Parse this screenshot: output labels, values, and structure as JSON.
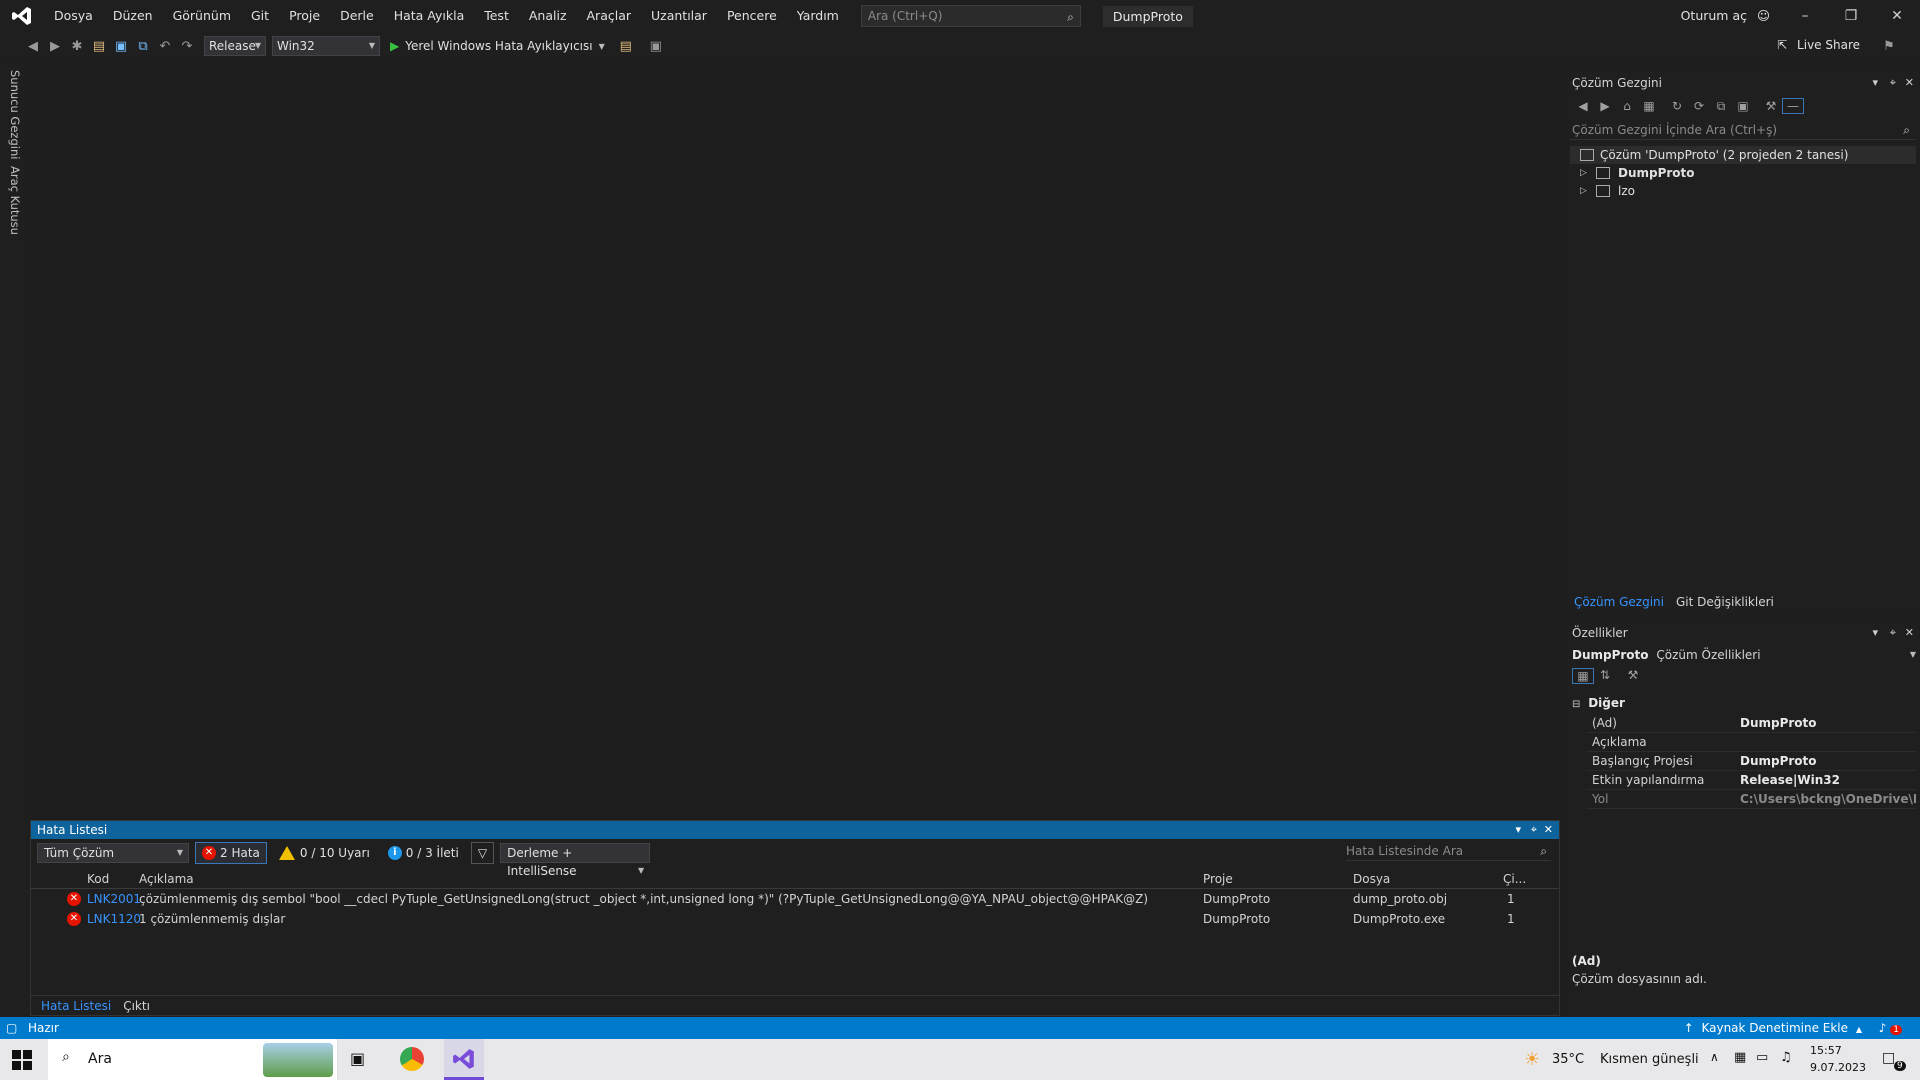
{
  "menu": {
    "items": [
      "Dosya",
      "Düzen",
      "Görünüm",
      "Git",
      "Proje",
      "Derle",
      "Hata Ayıkla",
      "Test",
      "Analiz",
      "Araçlar",
      "Uzantılar",
      "Pencere",
      "Yardım"
    ],
    "search_placeholder": "Ara (Ctrl+Q)",
    "solution_name": "DumpProto",
    "sign_in": "Oturum aç"
  },
  "toolbar": {
    "configuration": "Release",
    "platform": "Win32",
    "run_label": "Yerel Windows Hata Ayıklayıcısı",
    "live_share": "Live Share"
  },
  "left_tabs": {
    "server_explorer": "Sunucu Gezgini",
    "toolbox": "Araç Kutusu"
  },
  "error_list": {
    "title": "Hata Listesi",
    "scope": "Tüm Çözüm",
    "errors_filter": "2 Hata",
    "warnings_filter": "0 / 10 Uyarı",
    "messages_filter": "0 / 3 İleti",
    "source_filter": "Derleme + IntelliSense",
    "search_placeholder": "Hata Listesinde Ara",
    "columns": {
      "code": "Kod",
      "description": "Açıklama",
      "project": "Proje",
      "file": "Dosya",
      "line": "Çi..."
    },
    "rows": [
      {
        "code": "LNK2001",
        "description": "çözümlenmemiş dış sembol \"bool __cdecl PyTuple_GetUnsignedLong(struct _object *,int,unsigned long *)\" (?PyTuple_GetUnsignedLong@@YA_NPAU_object@@HPAK@Z)",
        "project": "DumpProto",
        "file": "dump_proto.obj",
        "line": "1"
      },
      {
        "code": "LNK1120",
        "description": "1 çözümlenmemiş dışlar",
        "project": "DumpProto",
        "file": "DumpProto.exe",
        "line": "1"
      }
    ],
    "bottom_tabs": [
      "Hata Listesi",
      "Çıktı"
    ]
  },
  "solution_explorer": {
    "title": "Çözüm Gezgini",
    "search_placeholder": "Çözüm Gezgini İçinde Ara (Ctrl+ş)",
    "tree": {
      "solution": "Çözüm 'DumpProto' (2 projeden 2 tanesi)",
      "project1": "DumpProto",
      "project2": "lzo"
    },
    "tabs": [
      "Çözüm Gezgini",
      "Git Değişiklikleri"
    ]
  },
  "properties": {
    "title": "Özellikler",
    "object_name": "DumpProto",
    "object_type": "Çözüm Özellikleri",
    "category": "Diğer",
    "rows": [
      {
        "key": "(Ad)",
        "value": "DumpProto"
      },
      {
        "key": "Açıklama",
        "value": ""
      },
      {
        "key": "Başlangıç Projesi",
        "value": "DumpProto"
      },
      {
        "key": "Etkin yapılandırma",
        "value": "Release|Win32"
      },
      {
        "key": "Yol",
        "value": "C:\\Users\\bckng\\OneDrive\\Masa"
      }
    ],
    "desc_title": "(Ad)",
    "desc_text": "Çözüm dosyasının adı."
  },
  "status_bar": {
    "ready": "Hazır",
    "source_control": "Kaynak Denetimine Ekle",
    "notification_count": "1"
  },
  "taskbar": {
    "search_label": "Ara",
    "weather_temp": "35°C",
    "weather_desc": "Kısmen güneşli",
    "time": "15:57",
    "date": "9.07.2023",
    "notif_count": "9"
  },
  "colors": {
    "accent": "#007acc",
    "error": "#e51400",
    "warning": "#f0c000",
    "info": "#1c97ea",
    "link": "#3794ff"
  }
}
